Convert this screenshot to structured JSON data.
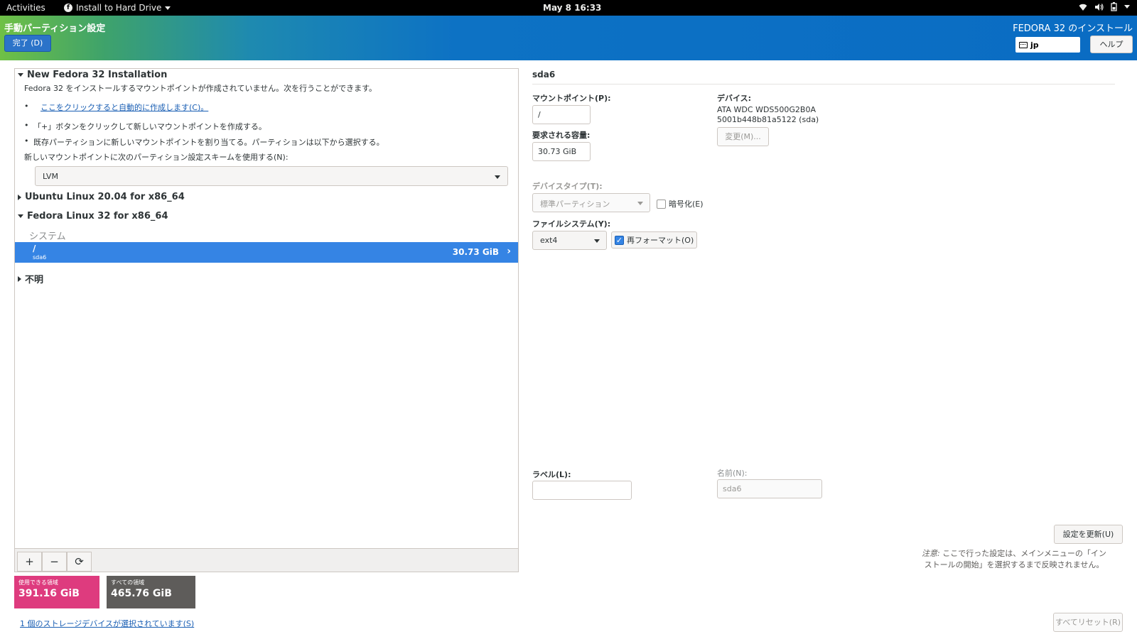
{
  "topbar": {
    "activities": "Activities",
    "app_menu": "Install to Hard Drive",
    "clock": "May 8  16:33",
    "icons": [
      "wifi-icon",
      "volume-icon",
      "battery-icon",
      "system-menu-chevron-icon"
    ]
  },
  "header": {
    "title": "手動パーティション設定",
    "done_button": "完了 (D)",
    "product": "FEDORA 32 のインストール",
    "keyboard_layout": "jp",
    "help_button": "ヘルプ"
  },
  "left": {
    "new_install_title": "New Fedora 32 Installation",
    "intro": "Fedora 32 をインストールするマウントポイントが作成されていません。次を行うことができます。",
    "auto_link": "ここをクリックすると自動的に作成します(C)。",
    "bullet_plus": "「+」ボタンをクリックして新しいマウントポイントを作成する。",
    "bullet_assign": "既存パーティションに新しいマウントポイントを割り当てる。パーティションは以下から選択する。",
    "scheme_label": "新しいマウントポイントに次のパーティション設定スキームを使用する(N):",
    "scheme_value": "LVM",
    "ubuntu_group": "Ubuntu Linux 20.04 for x86_64",
    "fedora_group": "Fedora Linux 32 for x86_64",
    "system_label": "システム",
    "selected_mount": "/",
    "selected_device": "sda6",
    "selected_size": "30.73 GiB",
    "unknown_group": "不明",
    "toolbar": {
      "add": "+",
      "remove": "−",
      "refresh": "⟳"
    }
  },
  "space": {
    "available_label": "使用できる領域",
    "available_value": "391.16 GiB",
    "available_color": "#de3b7e",
    "total_label": "すべての領域",
    "total_value": "465.76 GiB",
    "total_color": "#5e5c5a",
    "storage_link": "1 個のストレージデバイスが選択されています(S)"
  },
  "right": {
    "title": "sda6",
    "mount_point_label": "マウントポイント(P):",
    "mount_point_value": "/",
    "capacity_label": "要求される容量:",
    "capacity_value": "30.73 GiB",
    "device_label": "デバイス:",
    "device_line1": "ATA WDC WDS500G2B0A",
    "device_line2": "5001b448b81a5122 (sda)",
    "modify_button": "変更(M)...",
    "device_type_label": "デバイスタイプ(T):",
    "device_type_value": "標準パーティション",
    "encrypt_label": "暗号化(E)",
    "encrypt_checked": false,
    "filesystem_label": "ファイルシステム(Y):",
    "filesystem_value": "ext4",
    "reformat_label": "再フォーマット(O)",
    "reformat_checked": true,
    "label_label": "ラベル(L):",
    "label_value": "",
    "name_label": "名前(N):",
    "name_value": "sda6",
    "update_button": "設定を更新(U)",
    "note_prefix": "注意:",
    "note_text": " ここで行った設定は、メインメニューの「インストールの開始」を選択するまで反映されません。",
    "reset_button": "すべてリセット(R)"
  },
  "colors": {
    "accent": "#3584e4",
    "header_blue": "#0a6cc3",
    "link": "#1a5fb4"
  }
}
